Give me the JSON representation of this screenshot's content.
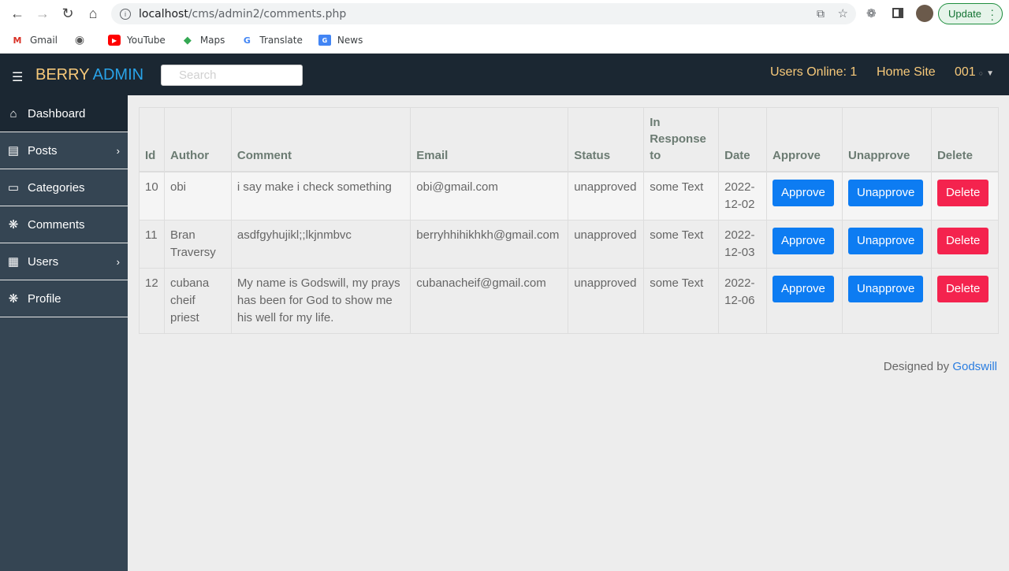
{
  "browser": {
    "url_host": "localhost",
    "url_path": "/cms/admin2/comments.php",
    "update_label": "Update",
    "bookmarks": [
      {
        "label": "Gmail",
        "icon": "gmail-icon"
      },
      {
        "label": "",
        "icon": "globe-icon"
      },
      {
        "label": "YouTube",
        "icon": "youtube-icon"
      },
      {
        "label": "Maps",
        "icon": "maps-icon"
      },
      {
        "label": "Translate",
        "icon": "translate-icon"
      },
      {
        "label": "News",
        "icon": "news-icon"
      }
    ]
  },
  "header": {
    "brand_part1": "BERRY",
    "brand_part2": "ADMIN",
    "search_placeholder": "Search",
    "users_online": "Users Online: 1",
    "home_site": "Home Site",
    "user_menu": "001",
    "colors": {
      "bg": "#1b2732",
      "accent": "#f7c97a",
      "brand2": "#29a3e8"
    }
  },
  "sidebar": {
    "items": [
      {
        "label": "Dashboard",
        "icon": "home-icon",
        "active": true
      },
      {
        "label": "Posts",
        "icon": "document-icon",
        "has_submenu": true
      },
      {
        "label": "Categories",
        "icon": "monitor-icon"
      },
      {
        "label": "Comments",
        "icon": "atom-icon"
      },
      {
        "label": "Users",
        "icon": "grid-icon",
        "has_submenu": true
      },
      {
        "label": "Profile",
        "icon": "atom-icon"
      }
    ]
  },
  "table": {
    "headers": {
      "id": "Id",
      "author": "Author",
      "comment": "Comment",
      "email": "Email",
      "status": "Status",
      "in_response_to": "In Response to",
      "date": "Date",
      "approve": "Approve",
      "unapprove": "Unapprove",
      "delete": "Delete"
    },
    "rows": [
      {
        "id": "10",
        "author": "obi",
        "comment": "i say make i check something",
        "email": "obi@gmail.com",
        "status": "unapproved",
        "in_response_to": "some Text",
        "date": "2022-12-02",
        "approve": "Approve",
        "unapprove": "Unapprove",
        "delete": "Delete"
      },
      {
        "id": "11",
        "author": "Bran Traversy",
        "comment": "asdfgyhujikl;;lkjnmbvc",
        "email": "berryhhihikhkh@gmail.com",
        "status": "unapproved",
        "in_response_to": "some Text",
        "date": "2022-12-03",
        "approve": "Approve",
        "unapprove": "Unapprove",
        "delete": "Delete"
      },
      {
        "id": "12",
        "author": "cubana cheif priest",
        "comment": "My name is Godswill, my prays has been for God to show me his well for my life.",
        "email": "cubanacheif@gmail.com",
        "status": "unapproved",
        "in_response_to": "some Text",
        "date": "2022-12-06",
        "approve": "Approve",
        "unapprove": "Unapprove",
        "delete": "Delete"
      }
    ]
  },
  "footer": {
    "prefix": "Designed by",
    "link": "Godswill"
  }
}
